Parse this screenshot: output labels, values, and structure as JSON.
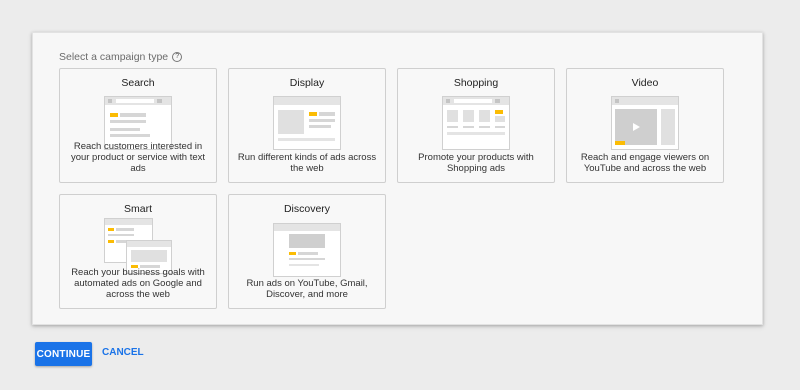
{
  "header": {
    "prompt": "Select a campaign type",
    "help_icon": "help-circle-icon",
    "help_glyph": "?"
  },
  "campaign_types": [
    {
      "title": "Search",
      "description": "Reach customers interested in your product or service with text ads",
      "illustration": "search-illustration-icon"
    },
    {
      "title": "Display",
      "description": "Run different kinds of ads across the web",
      "illustration": "display-illustration-icon"
    },
    {
      "title": "Shopping",
      "description": "Promote your products with Shopping ads",
      "illustration": "shopping-illustration-icon"
    },
    {
      "title": "Video",
      "description": "Reach and engage viewers on YouTube and across the web",
      "illustration": "video-illustration-icon"
    },
    {
      "title": "Smart",
      "description": "Reach your business goals with automated ads on Google and across the web",
      "illustration": "smart-illustration-icon"
    },
    {
      "title": "Discovery",
      "description": "Run ads on YouTube, Gmail, Discover, and more",
      "illustration": "discovery-illustration-icon"
    }
  ],
  "actions": {
    "continue_label": "CONTINUE",
    "cancel_label": "CANCEL"
  },
  "colors": {
    "accent": "#1a73e8",
    "highlight": "#fbbc04",
    "placeholder": "#d6d6d6"
  }
}
